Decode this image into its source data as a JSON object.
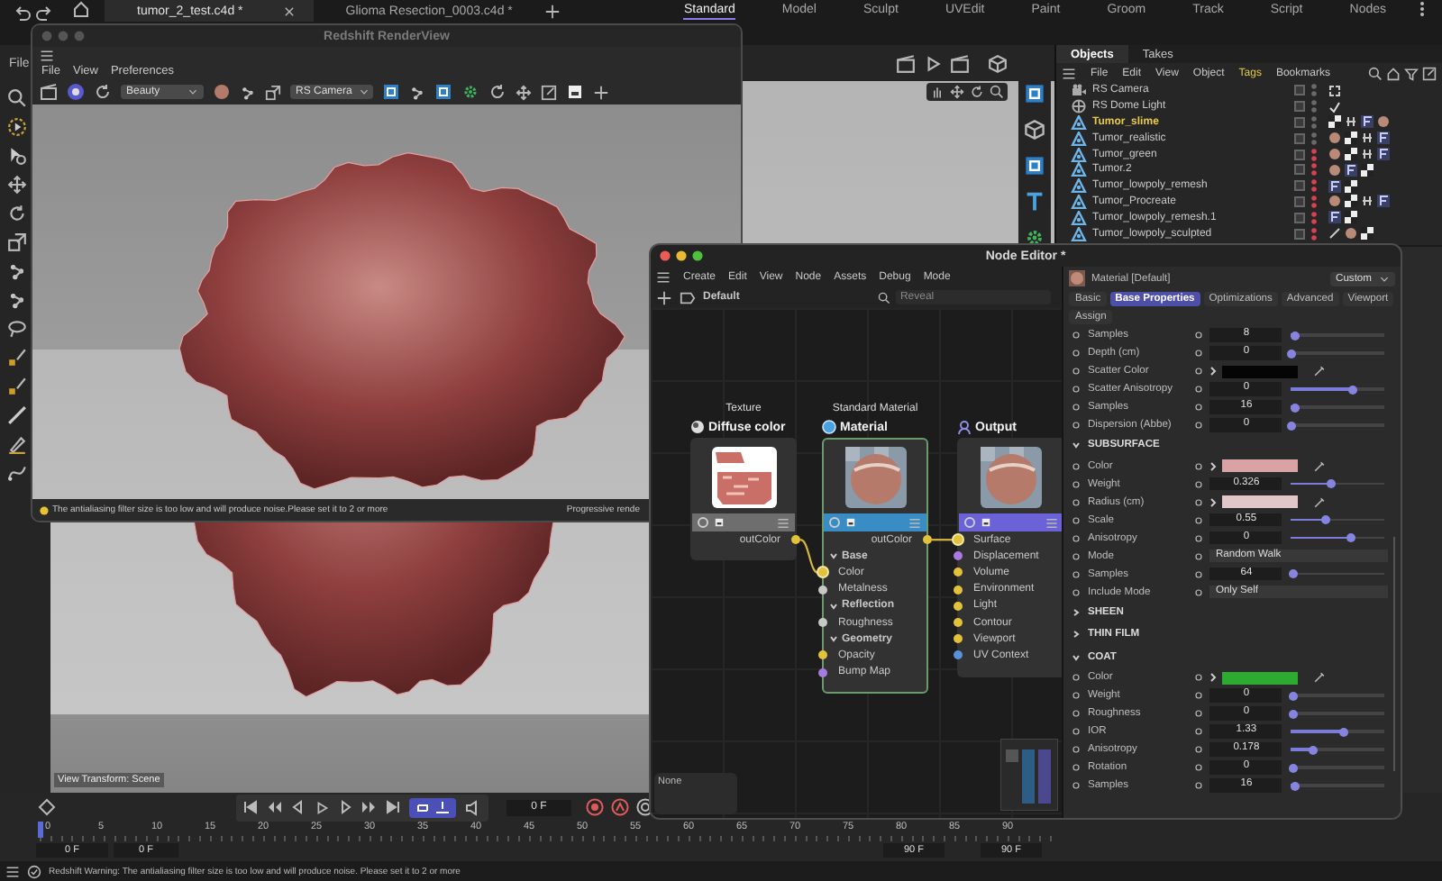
{
  "top_bar": {
    "file_tabs": [
      {
        "label": "tumor_2_test.c4d *",
        "selected": true
      },
      {
        "label": "Glioma Resection_0003.c4d *",
        "selected": false
      }
    ],
    "layouts": [
      {
        "label": "Standard",
        "selected": true
      },
      {
        "label": "Model",
        "selected": false
      },
      {
        "label": "Sculpt",
        "selected": false
      },
      {
        "label": "UVEdit",
        "selected": false
      },
      {
        "label": "Paint",
        "selected": false
      },
      {
        "label": "Groom",
        "selected": false
      },
      {
        "label": "Track",
        "selected": false
      },
      {
        "label": "Script",
        "selected": false
      },
      {
        "label": "Nodes",
        "selected": false
      }
    ]
  },
  "viewport": {
    "menu": [
      "File"
    ],
    "view_transform": "View Transform: Scene"
  },
  "render_view": {
    "title": "Redshift RenderView",
    "menu": [
      "File",
      "View",
      "Preferences"
    ],
    "aov": "Beauty",
    "camera": "RS Camera",
    "warning": "The antialiasing filter size is too low and will produce noise.Please set it to 2 or more",
    "status": "Progressive rende"
  },
  "objects_panel": {
    "tabs": [
      {
        "label": "Objects",
        "selected": true
      },
      {
        "label": "Takes",
        "selected": false
      }
    ],
    "menu": [
      "File",
      "Edit",
      "View",
      "Object",
      "Tags",
      "Bookmarks"
    ],
    "objects": [
      {
        "name": "RS Camera",
        "kind": "camera",
        "selected": false,
        "hidden": false,
        "tags": [
          {
            "kind": "target"
          }
        ]
      },
      {
        "name": "RS Dome Light",
        "kind": "light",
        "selected": false,
        "hidden": false,
        "tags": [
          {
            "kind": "check"
          }
        ]
      },
      {
        "name": "Tumor_slime",
        "kind": "mesh",
        "selected": true,
        "hidden": false,
        "tags": [
          {
            "kind": "checker"
          },
          {
            "kind": "phong"
          },
          {
            "kind": "uv"
          },
          {
            "kind": "material"
          }
        ]
      },
      {
        "name": "Tumor_realistic",
        "kind": "mesh",
        "selected": false,
        "hidden": false,
        "tags": [
          {
            "kind": "material"
          },
          {
            "kind": "checker"
          },
          {
            "kind": "phong"
          },
          {
            "kind": "uv"
          }
        ]
      },
      {
        "name": "Tumor_green",
        "kind": "mesh",
        "selected": false,
        "hidden": true,
        "tags": [
          {
            "kind": "material"
          },
          {
            "kind": "checker"
          },
          {
            "kind": "phong"
          },
          {
            "kind": "uv"
          }
        ]
      },
      {
        "name": "Tumor.2",
        "kind": "mesh",
        "selected": false,
        "hidden": true,
        "tags": [
          {
            "kind": "material"
          },
          {
            "kind": "uv"
          },
          {
            "kind": "checker"
          }
        ]
      },
      {
        "name": "Tumor_lowpoly_remesh",
        "kind": "mesh",
        "selected": false,
        "hidden": true,
        "tags": [
          {
            "kind": "uv"
          },
          {
            "kind": "checker"
          }
        ]
      },
      {
        "name": "Tumor_Procreate",
        "kind": "mesh",
        "selected": false,
        "hidden": true,
        "tags": [
          {
            "kind": "material"
          },
          {
            "kind": "checker"
          },
          {
            "kind": "phong"
          },
          {
            "kind": "uv"
          }
        ]
      },
      {
        "name": "Tumor_lowpoly_remesh.1",
        "kind": "mesh",
        "selected": false,
        "hidden": true,
        "tags": [
          {
            "kind": "uv"
          },
          {
            "kind": "checker"
          }
        ]
      },
      {
        "name": "Tumor_lowpoly_sculpted",
        "kind": "mesh",
        "selected": false,
        "hidden": true,
        "tags": [
          {
            "kind": "brush"
          },
          {
            "kind": "material"
          },
          {
            "kind": "checker"
          }
        ]
      }
    ]
  },
  "node_editor": {
    "title": "Node Editor *",
    "menu": [
      "Create",
      "Edit",
      "View",
      "Node",
      "Assets",
      "Debug",
      "Mode"
    ],
    "material": "Default",
    "search": {
      "placeholder": "Reveal"
    },
    "nodes": [
      {
        "kind": "texture",
        "type_label": "Texture",
        "title": "Diffuse color",
        "color": "#6e6e6e",
        "selected": false,
        "output": "outColor"
      },
      {
        "kind": "material",
        "type_label": "Standard Material",
        "title": "Material",
        "color": "#3a8cc4",
        "selected": true,
        "output": "outColor",
        "groups": [
          {
            "label": "Base",
            "expanded": true,
            "inputs": [
              {
                "label": "Color",
                "color": "#e2c23c",
                "connected": true
              },
              {
                "label": "Metalness",
                "color": "#c8c8c8",
                "connected": false
              }
            ]
          },
          {
            "label": "Reflection",
            "expanded": true,
            "inputs": [
              {
                "label": "Roughness",
                "color": "#c8c8c8",
                "connected": false
              }
            ]
          },
          {
            "label": "Geometry",
            "expanded": true,
            "inputs": [
              {
                "label": "Opacity",
                "color": "#e2c23c",
                "connected": false
              },
              {
                "label": "Bump Map",
                "color": "#a77be0",
                "connected": false
              }
            ]
          }
        ]
      },
      {
        "kind": "output",
        "title": "Output",
        "color": "#6a62d6",
        "selected": false,
        "inputs": [
          {
            "label": "Surface",
            "color": "#e2c23c",
            "connected": true
          },
          {
            "label": "Displacement",
            "color": "#a77be0",
            "connected": false
          },
          {
            "label": "Volume",
            "color": "#e2c23c",
            "connected": false
          },
          {
            "label": "Environment",
            "color": "#e2c23c",
            "connected": false
          },
          {
            "label": "Light",
            "color": "#e2c23c",
            "connected": false
          },
          {
            "label": "Contour",
            "color": "#e2c23c",
            "connected": false
          },
          {
            "label": "Viewport",
            "color": "#e2c23c",
            "connected": false
          },
          {
            "label": "UV Context",
            "color": "#5a92d8",
            "connected": false
          }
        ]
      }
    ],
    "note": "None",
    "attributes": {
      "header": "Material [Default]",
      "mode": "Custom",
      "tabs": [
        {
          "label": "Basic",
          "selected": false
        },
        {
          "label": "Base Properties",
          "selected": true
        },
        {
          "label": "Optimizations",
          "selected": false
        },
        {
          "label": "Advanced",
          "selected": false
        },
        {
          "label": "Viewport",
          "selected": false
        },
        {
          "label": "Assign",
          "selected": false
        }
      ],
      "rows": [
        {
          "kind": "number",
          "label": "Samples",
          "value": "8",
          "level": 0.03
        },
        {
          "kind": "number",
          "label": "Depth (cm)",
          "value": "0",
          "level": 0.0
        },
        {
          "kind": "color",
          "label": "Scatter Color",
          "color": "#050505"
        },
        {
          "kind": "number",
          "label": "Scatter Anisotropy",
          "value": "0",
          "level": 0.66
        },
        {
          "kind": "number",
          "label": "Samples",
          "value": "16",
          "level": 0.03
        },
        {
          "kind": "number",
          "label": "Dispersion (Abbe)",
          "value": "0",
          "level": 0.0
        },
        {
          "kind": "section",
          "label": "SUBSURFACE",
          "expanded": true
        },
        {
          "kind": "color",
          "label": "Color",
          "color": "#d9a2a4"
        },
        {
          "kind": "number",
          "label": "Weight",
          "value": "0.326",
          "level": 0.42
        },
        {
          "kind": "color",
          "label": "Radius (cm)",
          "color": "#e2c7c8"
        },
        {
          "kind": "number",
          "label": "Scale",
          "value": "0.55",
          "level": 0.36
        },
        {
          "kind": "number",
          "label": "Anisotropy",
          "value": "0",
          "level": 0.64
        },
        {
          "kind": "choice",
          "label": "Mode",
          "value": "Random Walk"
        },
        {
          "kind": "number",
          "label": "Samples",
          "value": "64",
          "level": 0.02
        },
        {
          "kind": "choice",
          "label": "Include Mode",
          "value": "Only Self"
        },
        {
          "kind": "section",
          "label": "SHEEN",
          "expanded": false
        },
        {
          "kind": "section",
          "label": "THIN FILM",
          "expanded": false
        },
        {
          "kind": "section",
          "label": "COAT",
          "expanded": true
        },
        {
          "kind": "color",
          "label": "Color",
          "color": "#2eaa32"
        },
        {
          "kind": "number",
          "label": "Weight",
          "value": "0",
          "level": 0.02
        },
        {
          "kind": "number",
          "label": "Roughness",
          "value": "0",
          "level": 0.02
        },
        {
          "kind": "number",
          "label": "IOR",
          "value": "1.33",
          "level": 0.55
        },
        {
          "kind": "number",
          "label": "Anisotropy",
          "value": "0.178",
          "level": 0.24
        },
        {
          "kind": "number",
          "label": "Rotation",
          "value": "0",
          "level": 0.02
        },
        {
          "kind": "number",
          "label": "Samples",
          "value": "16",
          "level": 0.03
        }
      ]
    }
  },
  "timeline": {
    "current_frame": "0 F",
    "ticks": [
      "0",
      "5",
      "10",
      "15",
      "20",
      "25",
      "30",
      "35",
      "40",
      "45",
      "50",
      "55",
      "60",
      "65",
      "70",
      "75",
      "80",
      "85",
      "90"
    ],
    "range_start": "0 F",
    "preview_start": "0 F",
    "preview_end": "90 F",
    "range_end": "90 F"
  },
  "status_bar": {
    "message": "Redshift Warning: The antialiasing filter size is too low and will produce noise. Please set it to 2 or more"
  }
}
